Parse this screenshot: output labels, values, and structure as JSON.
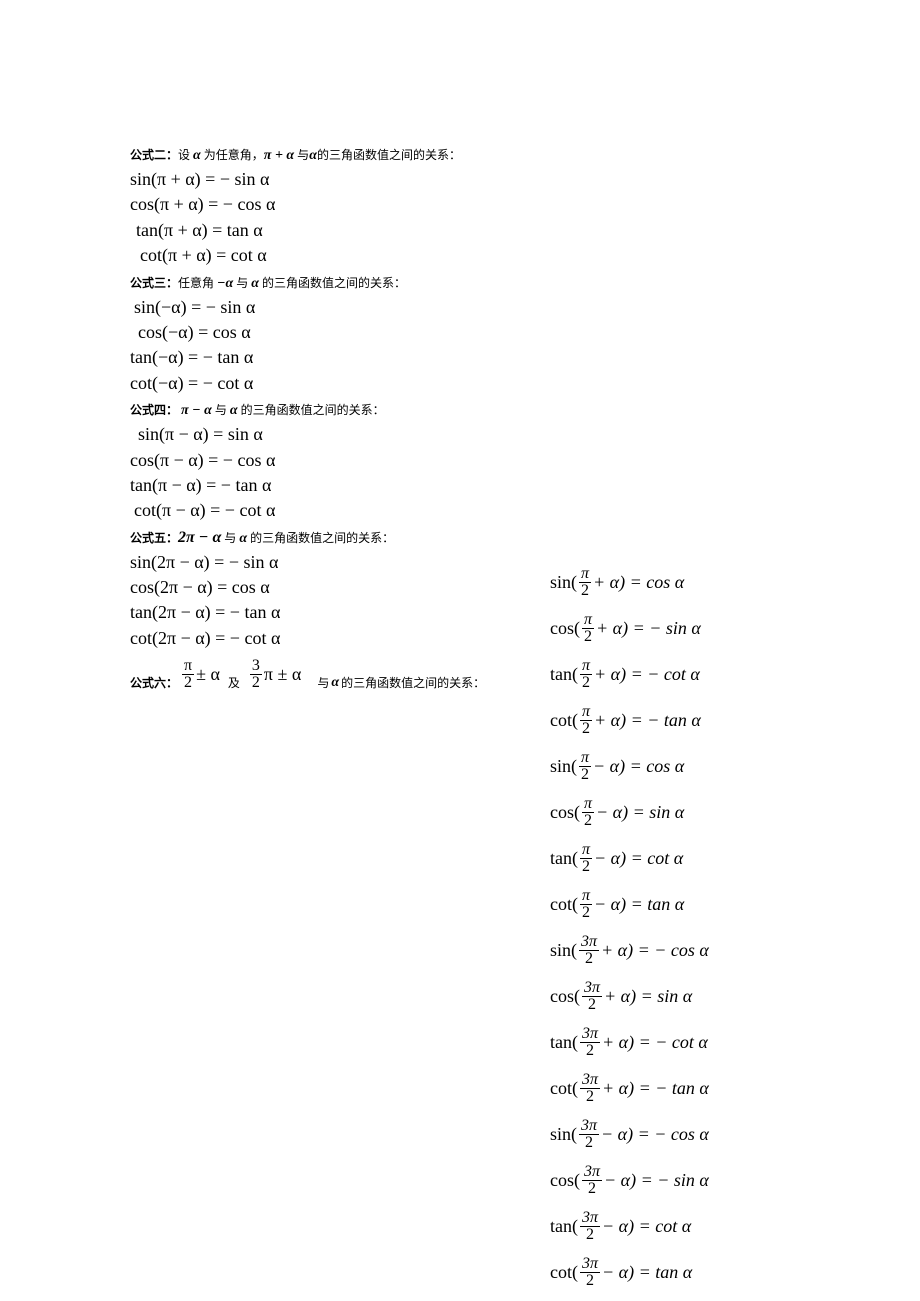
{
  "h2": {
    "label": "公式二：",
    "text_before": "设 ",
    "alpha": "α",
    "text_mid1": " 为任意角，",
    "expr": "π + α",
    "text_mid2": " 与",
    "alpha2": "α",
    "text_after": "的三角函数值之间的关系："
  },
  "f2": [
    "sin(π + α) = − sin α",
    "cos(π + α) = − cos α",
    "tan(π + α) = tan α",
    "cot(π + α) = cot α"
  ],
  "h3": {
    "label": "公式三：",
    "text_before": "任意角 ",
    "expr1": "−α",
    "text_mid": " 与 ",
    "expr2": "α",
    "text_after": " 的三角函数值之间的关系："
  },
  "f3": [
    "sin(−α) = − sin α",
    "cos(−α) = cos α",
    "tan(−α) = − tan α",
    "cot(−α) = − cot α"
  ],
  "h4": {
    "label": "公式四：",
    "expr1": "π − α",
    "text_mid": " 与 ",
    "expr2": "α",
    "text_after": " 的三角函数值之间的关系："
  },
  "f4": [
    "sin(π − α) = sin α",
    "cos(π − α) = − cos α",
    "tan(π − α) = − tan α",
    "cot(π − α) = − cot α"
  ],
  "h5": {
    "label": "公式五：",
    "expr1": "2π − α",
    "text_mid": " 与 ",
    "expr2": "α",
    "text_after": " 的三角函数值之间的关系："
  },
  "f5": [
    "sin(2π − α) = − sin α",
    "cos(2π − α) = cos α",
    "tan(2π − α) = − tan α",
    "cot(2π − α) = − cot α"
  ],
  "h6": {
    "label": "公式六：",
    "frac1_num": "π",
    "frac1_den": "2",
    "pm_alpha": " ± α",
    "and": "及",
    "frac2_num": "3",
    "frac2_den": "2",
    "pi_pm_alpha": "π ± α",
    "text_mid": "与 ",
    "alpha": "α",
    "text_after": " 的三角函数值之间的关系："
  },
  "f6": [
    {
      "fn": "sin(",
      "num": "π",
      "den": "2",
      "arg": " + α) = cos α"
    },
    {
      "fn": "cos(",
      "num": "π",
      "den": "2",
      "arg": " + α) = − sin α"
    },
    {
      "fn": "tan(",
      "num": "π",
      "den": "2",
      "arg": " + α) = − cot α"
    },
    {
      "fn": "cot(",
      "num": "π",
      "den": "2",
      "arg": " + α) = − tan α"
    },
    {
      "fn": "sin(",
      "num": "π",
      "den": "2",
      "arg": " − α) = cos α"
    },
    {
      "fn": "cos(",
      "num": "π",
      "den": "2",
      "arg": " − α) = sin α"
    },
    {
      "fn": "tan(",
      "num": "π",
      "den": "2",
      "arg": " − α) = cot α"
    },
    {
      "fn": "cot(",
      "num": "π",
      "den": "2",
      "arg": " − α) = tan α"
    },
    {
      "fn": "sin(",
      "num": "3π",
      "den": "2",
      "arg": " + α) = − cos α"
    },
    {
      "fn": "cos(",
      "num": "3π",
      "den": "2",
      "arg": " + α) = sin α"
    },
    {
      "fn": "tan(",
      "num": "3π",
      "den": "2",
      "arg": " + α) = − cot α"
    },
    {
      "fn": "cot(",
      "num": "3π",
      "den": "2",
      "arg": " + α) = − tan α"
    },
    {
      "fn": "sin(",
      "num": "3π",
      "den": "2",
      "arg": " − α) = − cos α"
    },
    {
      "fn": "cos(",
      "num": "3π",
      "den": "2",
      "arg": " − α) = − sin α"
    },
    {
      "fn": "tan(",
      "num": "3π",
      "den": "2",
      "arg": " − α) = cot α"
    },
    {
      "fn": "cot(",
      "num": "3π",
      "den": "2",
      "arg": " − α) = tan α"
    }
  ]
}
